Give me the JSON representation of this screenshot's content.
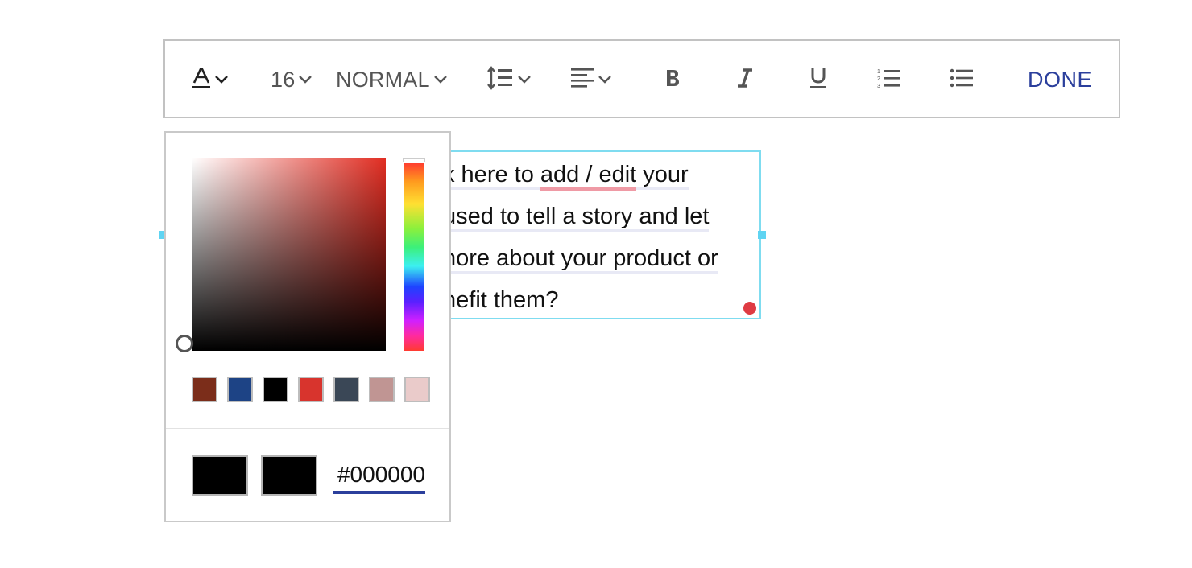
{
  "toolbar": {
    "font_size": "16",
    "text_style": "NORMAL",
    "done_label": "DONE"
  },
  "textbox": {
    "lines": [
      "k here to ",
      "add / edit",
      " your",
      "used to tell a story and let",
      "nore about your product or",
      "nefit them?"
    ]
  },
  "picker": {
    "sv_hue_color": "#e12d22",
    "swatches": [
      "#7b2d1a",
      "#1d4385",
      "#000000",
      "#d8342d",
      "#3a4756",
      "#c09593",
      "#eacbca"
    ],
    "previous_color": "#000000",
    "current_color": "#000000",
    "hex_value": "#000000"
  },
  "icons": {
    "font_color": "font-color-icon",
    "line_height": "line-height-icon",
    "align": "align-left-icon",
    "bold": "bold-icon",
    "italic": "italic-icon",
    "underline": "underline-icon",
    "ordered_list": "ordered-list-icon",
    "bullet_list": "bullet-list-icon"
  },
  "colors": {
    "accent": "#2b3f9c",
    "selection_border": "#7fdcf0",
    "spell_underline": "#ef9aa5",
    "indicator_dot": "#df3b43"
  }
}
